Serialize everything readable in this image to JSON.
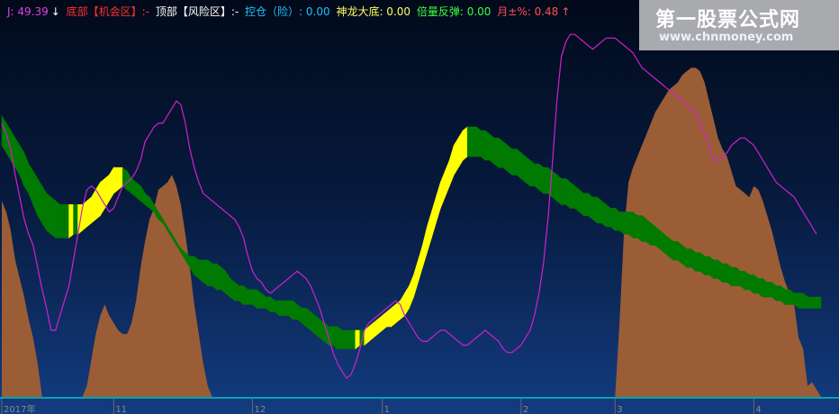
{
  "legend": {
    "j": "J: 49.39",
    "j_arrow": "↓",
    "bottom": "底部【机会区】:-",
    "top": "顶部【风险区】:-",
    "control": "控仓（险）: 0.00",
    "dragon": "神龙大底: 0.00",
    "rebound": "倍量反弹: 0.00",
    "month": "月±%: 0.48",
    "month_arrow": "↑"
  },
  "watermark": {
    "line1": "第一股票公式网",
    "line2": "www.chnmoney.com"
  },
  "colors": {
    "j_text": "#e040e0",
    "bottom_text": "#ff3030",
    "top_text": "#ffffff",
    "control_text": "#20c0ff",
    "dragon_text": "#ffff60",
    "rebound_text": "#40ff40",
    "month_text": "#ff5050",
    "band_up": "#ffff00",
    "band_down": "#007a00",
    "area_fill": "#9b5d36",
    "j_line": "#d020d0",
    "baseline": "#00c8c8"
  },
  "chart_data": {
    "type": "area",
    "x_ticks": [
      "2017年",
      "11",
      "12",
      "1",
      "2",
      "3",
      "4"
    ],
    "x_tick_index": [
      0,
      25,
      56,
      85,
      116,
      137,
      168
    ],
    "count": 184,
    "ylim": [
      0,
      100
    ],
    "area_values": [
      53,
      50,
      45,
      37,
      32,
      27,
      21,
      16,
      9,
      0,
      0,
      0,
      0,
      0,
      0,
      0,
      0,
      0,
      0,
      3,
      10,
      17,
      22,
      25,
      22,
      20,
      18,
      17,
      17,
      20,
      26,
      35,
      42,
      48,
      51,
      56,
      57,
      58,
      60,
      57,
      52,
      44,
      35,
      25,
      17,
      9,
      3,
      0,
      0,
      0,
      0,
      0,
      0,
      0,
      0,
      0,
      0,
      0,
      0,
      0,
      0,
      0,
      0,
      0,
      0,
      0,
      0,
      0,
      0,
      0,
      0,
      0,
      0,
      0,
      0,
      0,
      0,
      0,
      0,
      0,
      0,
      0,
      0,
      0,
      0,
      0,
      0,
      0,
      0,
      0,
      0,
      0,
      0,
      0,
      0,
      0,
      0,
      0,
      0,
      0,
      0,
      0,
      0,
      0,
      0,
      0,
      0,
      0,
      0,
      0,
      0,
      0,
      0,
      0,
      0,
      0,
      0,
      0,
      0,
      0,
      0,
      0,
      0,
      0,
      0,
      0,
      0,
      0,
      0,
      0,
      0,
      0,
      0,
      0,
      0,
      0,
      0,
      0,
      20,
      45,
      58,
      62,
      65,
      68,
      71,
      74,
      77,
      79,
      81,
      83,
      84,
      85,
      87,
      88,
      89,
      89,
      88,
      85,
      80,
      75,
      70,
      67,
      65,
      61,
      57,
      56,
      55,
      54,
      57,
      56,
      53,
      49,
      45,
      40,
      35,
      31,
      28,
      25,
      16,
      13,
      3,
      4
    ],
    "j_values": [
      74,
      71,
      67,
      60,
      54,
      48,
      44,
      41,
      35,
      29,
      24,
      18,
      18,
      22,
      26,
      30,
      37,
      44,
      51,
      56,
      57,
      56,
      54,
      52,
      50,
      51,
      54,
      57,
      58,
      59,
      61,
      64,
      69,
      71,
      73,
      74,
      74,
      76,
      78,
      80,
      79,
      74,
      67,
      62,
      58,
      55,
      54,
      53,
      52,
      51,
      50,
      49,
      48,
      46,
      43,
      38,
      34,
      32,
      31,
      29,
      28,
      29,
      30,
      31,
      32,
      33,
      34,
      33,
      32,
      30,
      27,
      24,
      20,
      16,
      12,
      9,
      7,
      5,
      6,
      9,
      13,
      18,
      20,
      21,
      22,
      23,
      24,
      25,
      26,
      25,
      22,
      20,
      18,
      16,
      15,
      15,
      16,
      17,
      18,
      18,
      17,
      16,
      15,
      14,
      14,
      15,
      16,
      17,
      18,
      17,
      16,
      15,
      13,
      12,
      12,
      13,
      14,
      16,
      18,
      22,
      28,
      36,
      48,
      63,
      80,
      92,
      96,
      98,
      98,
      97,
      96,
      95,
      94,
      95,
      96,
      97,
      97,
      97,
      96,
      95,
      94,
      93,
      91,
      89,
      88,
      87,
      86,
      85,
      84,
      83,
      82,
      81,
      80,
      79,
      78,
      77,
      74,
      71,
      68,
      64,
      64,
      65,
      66,
      68,
      69,
      70,
      70,
      69,
      68,
      66,
      64,
      62,
      60,
      58,
      57,
      56,
      55,
      54,
      52,
      50,
      48,
      46,
      44
    ],
    "band_upper": [
      76,
      74,
      72,
      70,
      68,
      66,
      63,
      61,
      59,
      57,
      55,
      54,
      53,
      52,
      52,
      52,
      52,
      52,
      52,
      53,
      54,
      56,
      58,
      59,
      60,
      62,
      62,
      62,
      61,
      59,
      58,
      57,
      55,
      54,
      52,
      50,
      48,
      46,
      44,
      42,
      40,
      39,
      38,
      38,
      37,
      37,
      37,
      36,
      36,
      35,
      34,
      32,
      31,
      30,
      30,
      29,
      29,
      29,
      28,
      27,
      27,
      26,
      26,
      26,
      26,
      26,
      25,
      24,
      24,
      23,
      22,
      21,
      20,
      19,
      19,
      19,
      18,
      18,
      18,
      18,
      18,
      18,
      19,
      20,
      21,
      22,
      23,
      24,
      25,
      26,
      28,
      30,
      33,
      37,
      41,
      46,
      50,
      54,
      58,
      61,
      64,
      68,
      70,
      72,
      73,
      73,
      73,
      72,
      72,
      71,
      70,
      70,
      69,
      68,
      67,
      67,
      66,
      65,
      64,
      63,
      63,
      62,
      62,
      61,
      60,
      59,
      59,
      58,
      57,
      56,
      55,
      55,
      54,
      54,
      53,
      52,
      51,
      51,
      50,
      50,
      50,
      50,
      49,
      49,
      48,
      47,
      46,
      45,
      44,
      43,
      42,
      42,
      41,
      40,
      40,
      39,
      39,
      38,
      38,
      37,
      37,
      36,
      36,
      35,
      35,
      34,
      34,
      33,
      33,
      32,
      32,
      31,
      31,
      30,
      30,
      29,
      29,
      28,
      28,
      28,
      27,
      27,
      27,
      27
    ],
    "band_lower": [
      68,
      66,
      64,
      62,
      60,
      57,
      55,
      52,
      49,
      47,
      45,
      44,
      43,
      43,
      43,
      43,
      44,
      44,
      45,
      46,
      47,
      48,
      49,
      51,
      53,
      55,
      56,
      57,
      56,
      55,
      54,
      53,
      52,
      51,
      50,
      48,
      47,
      45,
      43,
      41,
      39,
      37,
      35,
      33,
      32,
      31,
      30,
      30,
      29,
      29,
      28,
      27,
      26,
      26,
      25,
      25,
      25,
      24,
      24,
      24,
      23,
      23,
      22,
      22,
      22,
      21,
      21,
      20,
      19,
      18,
      17,
      16,
      15,
      14,
      14,
      13,
      13,
      13,
      13,
      13,
      14,
      14,
      15,
      16,
      17,
      18,
      19,
      19,
      20,
      21,
      22,
      24,
      27,
      31,
      35,
      39,
      43,
      47,
      51,
      54,
      57,
      60,
      62,
      64,
      65,
      65,
      65,
      65,
      64,
      64,
      63,
      62,
      62,
      61,
      60,
      60,
      59,
      58,
      57,
      57,
      56,
      55,
      55,
      54,
      53,
      52,
      52,
      51,
      51,
      50,
      49,
      49,
      48,
      47,
      47,
      46,
      46,
      45,
      45,
      44,
      44,
      43,
      43,
      42,
      42,
      41,
      41,
      40,
      39,
      38,
      37,
      37,
      36,
      35,
      35,
      34,
      34,
      33,
      33,
      32,
      32,
      31,
      31,
      30,
      30,
      30,
      29,
      29,
      28,
      28,
      27,
      27,
      27,
      26,
      26,
      25,
      25,
      25,
      24,
      24,
      24,
      24,
      24,
      24
    ]
  }
}
